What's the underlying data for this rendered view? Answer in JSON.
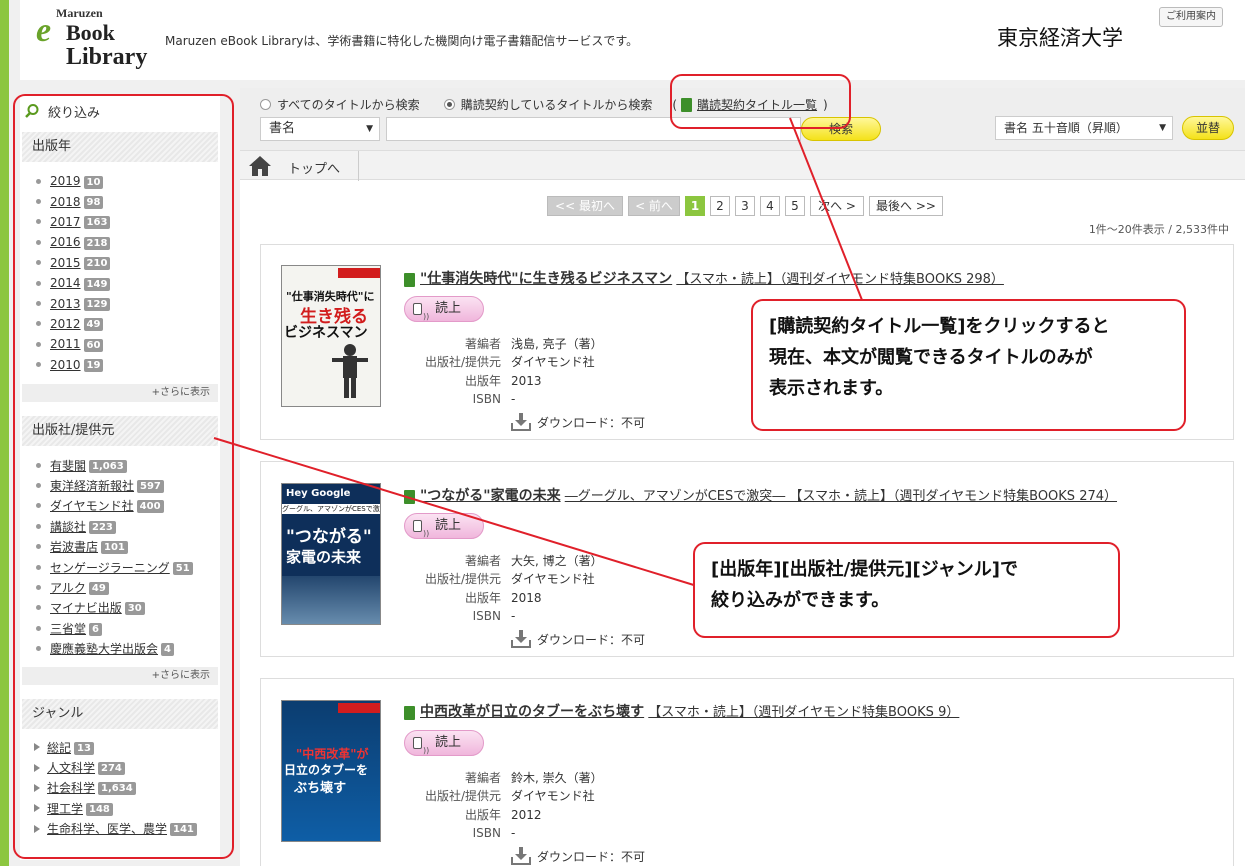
{
  "header": {
    "logo": {
      "line1": "Maruzen",
      "line2": "e",
      "line3": "Book",
      "line4": "Library"
    },
    "tagline": "Maruzen eBook Libraryは、学術書籍に特化した機関向け電子書籍配信サービスです。",
    "university": "東京経済大学",
    "help": "ご利用案内"
  },
  "sidebar": {
    "title": "絞り込み",
    "year": {
      "heading": "出版年",
      "items": [
        {
          "label": "2019",
          "count": "10"
        },
        {
          "label": "2018",
          "count": "98"
        },
        {
          "label": "2017",
          "count": "163"
        },
        {
          "label": "2016",
          "count": "218"
        },
        {
          "label": "2015",
          "count": "210"
        },
        {
          "label": "2014",
          "count": "149"
        },
        {
          "label": "2013",
          "count": "129"
        },
        {
          "label": "2012",
          "count": "49"
        },
        {
          "label": "2011",
          "count": "60"
        },
        {
          "label": "2010",
          "count": "19"
        }
      ],
      "more": "+さらに表示"
    },
    "publisher": {
      "heading": "出版社/提供元",
      "items": [
        {
          "label": "有斐閣",
          "count": "1,063"
        },
        {
          "label": "東洋経済新報社",
          "count": "597"
        },
        {
          "label": "ダイヤモンド社",
          "count": "400"
        },
        {
          "label": "講談社",
          "count": "223"
        },
        {
          "label": "岩波書店",
          "count": "101"
        },
        {
          "label": "センゲージラーニング",
          "count": "51"
        },
        {
          "label": "アルク",
          "count": "49"
        },
        {
          "label": "マイナビ出版",
          "count": "30"
        },
        {
          "label": "三省堂",
          "count": "6"
        },
        {
          "label": "慶應義塾大学出版会",
          "count": "4"
        }
      ],
      "more": "+さらに表示"
    },
    "genre": {
      "heading": "ジャンル",
      "items": [
        {
          "label": "総記",
          "count": "13"
        },
        {
          "label": "人文科学",
          "count": "274"
        },
        {
          "label": "社会科学",
          "count": "1,634"
        },
        {
          "label": "理工学",
          "count": "148"
        },
        {
          "label": "生命科学、医学、農学",
          "count": "141"
        }
      ]
    }
  },
  "search": {
    "radio_all": "すべてのタイトルから検索",
    "radio_sub": "購読契約しているタイトルから検索",
    "paren_open": "(",
    "paren_close": ")",
    "sub_list_link": "購読契約タイトル一覧",
    "field_select": "書名",
    "search_button": "検索",
    "sort_select": "書名 五十音順（昇順）",
    "sort_button": "並替"
  },
  "nav": {
    "top": "トップへ"
  },
  "pager": {
    "first": "<< 最初へ",
    "prev": "< 前へ",
    "pages": [
      "1",
      "2",
      "3",
      "4",
      "5"
    ],
    "next": "次へ >",
    "last": "最後へ >>",
    "count": "1件～20件表示 / 2,533件中"
  },
  "labels": {
    "author": "著編者",
    "publisher": "出版社/提供元",
    "year": "出版年",
    "isbn": "ISBN",
    "read": "読上",
    "download": "ダウンロード：不可"
  },
  "books": [
    {
      "title": "\"仕事消失時代\"に生き残るビジネスマン",
      "rest": "【スマホ・読上】（週刊ダイヤモンド特集BOOKS 298）",
      "author": "浅島, 亮子（著）",
      "publisher": "ダイヤモンド社",
      "year": "2013",
      "isbn": "-",
      "cover": {
        "top": "\"仕事消失時代\"に",
        "mid": "生き残る",
        "bottom": "ビジネスマン"
      }
    },
    {
      "title": "\"つながる\"家電の未来",
      "rest": "―グーグル、アマゾンがCESで激突― 【スマホ・読上】（週刊ダイヤモンド特集BOOKS 274）",
      "author": "大矢, 博之（著）",
      "publisher": "ダイヤモンド社",
      "year": "2018",
      "isbn": "-",
      "cover": {
        "top": "Hey Google",
        "sub": "グーグル、アマゾンがCESで激突",
        "mid": "\"つながる\"",
        "bottom": "家電の未来"
      }
    },
    {
      "title": "中西改革が日立のタブーをぶち壊す",
      "rest": "【スマホ・読上】（週刊ダイヤモンド特集BOOKS 9）",
      "author": "鈴木, 崇久（著）",
      "publisher": "ダイヤモンド社",
      "year": "2012",
      "isbn": "-",
      "cover": {
        "top": "\"中西改革\"が",
        "mid": "日立のタブーを",
        "bottom": "ぶち壊す"
      }
    }
  ],
  "callouts": {
    "one_l1": "[購読契約タイトル一覧]をクリックすると",
    "one_l2": "現在、本文が閲覧できるタイトルのみが",
    "one_l3": "表示されます。",
    "two_l1": "[出版年][出版社/提供元][ジャンル]で",
    "two_l2": "絞り込みができます。"
  },
  "colors": {
    "accent_green": "#8cc63f",
    "annotation_red": "#e0202a",
    "button_yellow": "#f4e21a"
  }
}
